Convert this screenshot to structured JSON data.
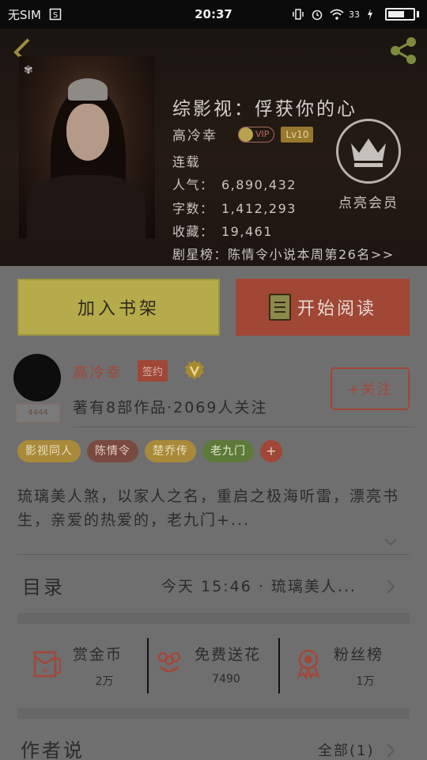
{
  "status_bar": {
    "carrier": "无SIM",
    "time": "20:37",
    "signal_text": "33"
  },
  "book": {
    "title": "综影视：俘获你的心",
    "author": "高冷幸",
    "vip_label": "VIP",
    "level": "Lv10",
    "status": "连载",
    "info": [
      {
        "label": "人气：",
        "value": "6,890,432"
      },
      {
        "label": "字数：",
        "value": "1,412,293"
      },
      {
        "label": "收藏：",
        "value": "19,461"
      }
    ],
    "ranking": "剧星榜：陈情令小说本周第26名>>",
    "vip_button_label": "点亮会员"
  },
  "actions": {
    "add_to_shelf": "加入书架",
    "start_reading": "开始阅读"
  },
  "author_card": {
    "name": "高冷幸",
    "sign_badge": "签约",
    "stats": "著有8部作品·2069人关注",
    "follow_label": "+关注",
    "avatar_tag": "4444"
  },
  "tags": [
    {
      "label": "影视同人",
      "bg": "#a98a3a",
      "fg": "#e9dfbe"
    },
    {
      "label": "陈情令",
      "bg": "#7a4940",
      "fg": "#e8cfc8"
    },
    {
      "label": "楚乔传",
      "bg": "#a98a3a",
      "fg": "#e9dfbe"
    },
    {
      "label": "老九门",
      "bg": "#5e7a3a",
      "fg": "#dfe8c8"
    }
  ],
  "tags_more": "+",
  "synopsis": "琉璃美人煞，以家人之名，重启之极海听雷，漂亮书生，亲爱的热爱的，老九门+...",
  "toc": {
    "label": "目录",
    "latest": "今天 15:46 · 琉璃美人..."
  },
  "stats": [
    {
      "icon": "red-envelope-icon",
      "title": "赏金币",
      "value": "2万"
    },
    {
      "icon": "flower-icon",
      "title": "免费送花",
      "value": "7490"
    },
    {
      "icon": "medal-icon",
      "title": "粉丝榜",
      "value": "1万"
    }
  ],
  "remarks": {
    "label": "作者说",
    "all": "全部(1)"
  },
  "colors": {
    "accent_red": "#a04735",
    "shelf_yellow": "#b5ab4a",
    "page_bg": "#6f6f6f",
    "header_bg": "#1a1411"
  }
}
